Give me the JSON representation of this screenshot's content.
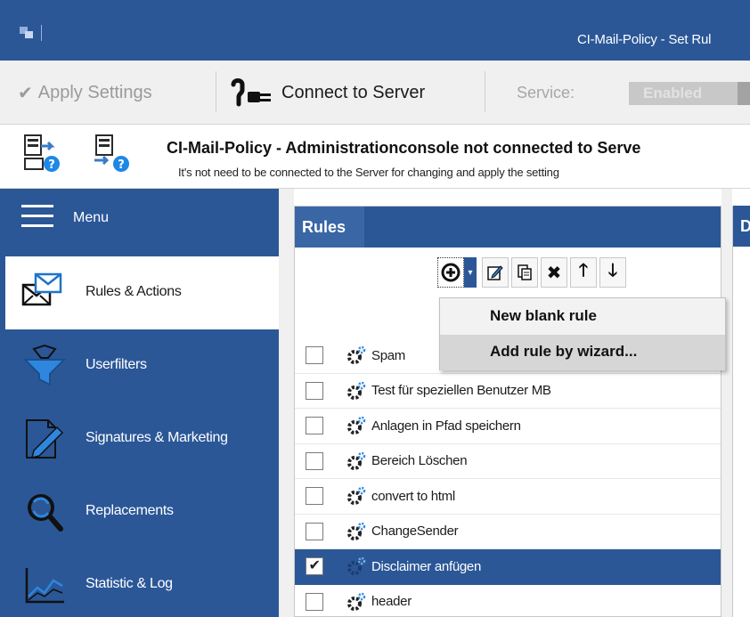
{
  "window": {
    "title": "CI-Mail-Policy - Set Rul"
  },
  "toolbar": {
    "apply_label": "Apply Settings",
    "connect_label": "Connect to Server",
    "service_label": "Service:",
    "service_state": "Enabled"
  },
  "info": {
    "headline": "CI-Mail-Policy - Administrationconsole not connected to Serve",
    "subline": "It's not need to be connected to the Server for changing and apply the setting"
  },
  "sidebar": {
    "menu_label": "Menu",
    "items": [
      {
        "label": "Rules & Actions",
        "icon": "envelope-icon",
        "active": true
      },
      {
        "label": "Userfilters",
        "icon": "funnel-icon",
        "active": false
      },
      {
        "label": "Signatures & Marketing",
        "icon": "signature-icon",
        "active": false
      },
      {
        "label": "Replacements",
        "icon": "replace-search-icon",
        "active": false
      },
      {
        "label": "Statistic & Log",
        "icon": "chart-icon",
        "active": false
      }
    ]
  },
  "rules_panel": {
    "title": "Rules",
    "tools": [
      "add-icon",
      "dropdown-arrow-icon",
      "edit-icon",
      "copy-icon",
      "delete-icon",
      "move-up-icon",
      "move-down-icon"
    ],
    "dropdown": {
      "items": [
        "New blank rule",
        "Add rule by wizard..."
      ],
      "hovered_index": 1
    },
    "rules": [
      {
        "name": "Spam",
        "checked": false,
        "selected": false
      },
      {
        "name": "Test für speziellen Benutzer MB",
        "checked": false,
        "selected": false
      },
      {
        "name": "Anlagen in Pfad speichern",
        "checked": false,
        "selected": false
      },
      {
        "name": "Bereich Löschen",
        "checked": false,
        "selected": false
      },
      {
        "name": "convert to html",
        "checked": false,
        "selected": false
      },
      {
        "name": "ChangeSender",
        "checked": false,
        "selected": false
      },
      {
        "name": "Disclaimer anfügen",
        "checked": true,
        "selected": true
      },
      {
        "name": "header",
        "checked": false,
        "selected": false
      }
    ]
  },
  "right_panel": {
    "title": "D"
  },
  "colors": {
    "accent": "#2b5797",
    "toolbar_bg": "#f0f0f0",
    "dropdown_hover": "#d6d6d6"
  }
}
